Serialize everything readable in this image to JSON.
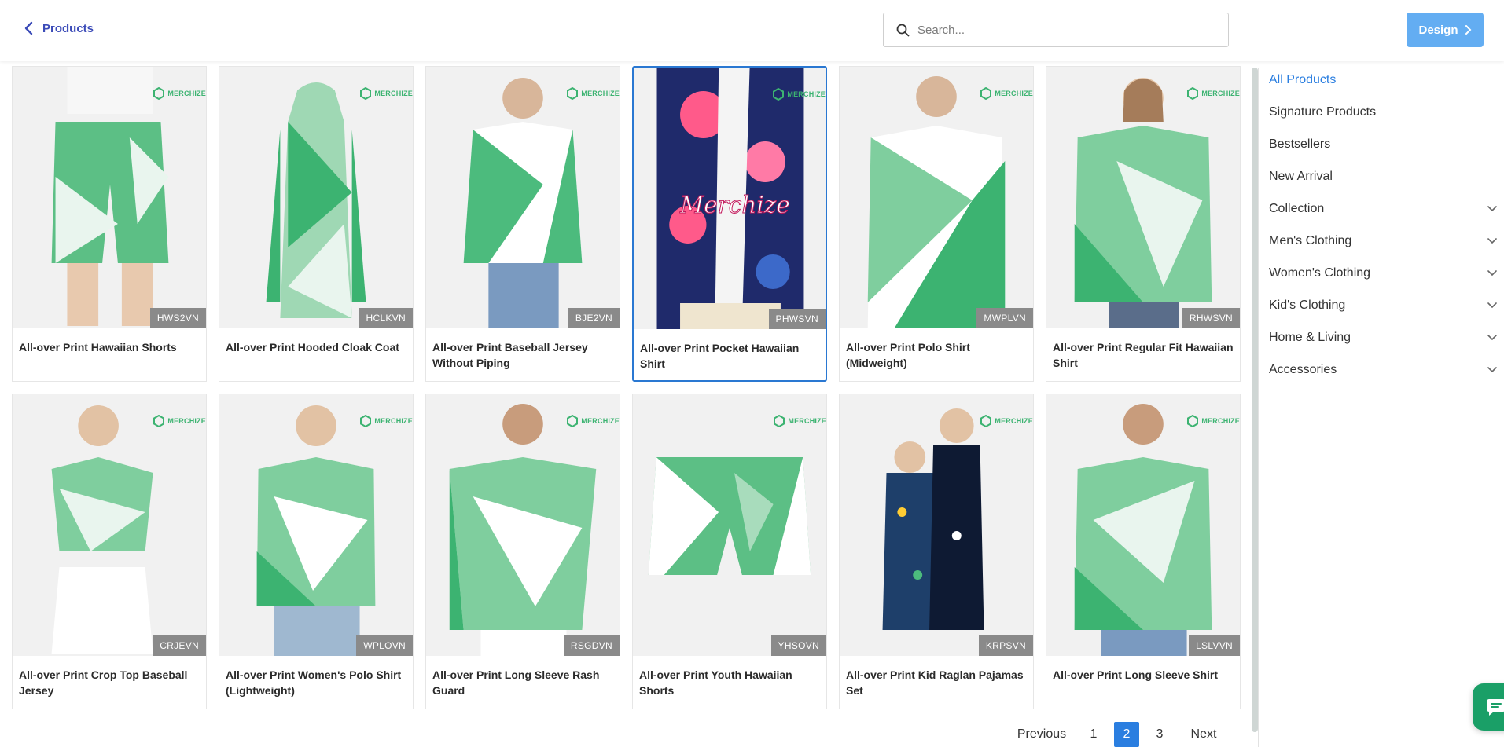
{
  "header": {
    "back_label": "Products",
    "search_placeholder": "Search...",
    "design_label": "Design"
  },
  "brand_text": "MERCHIZE",
  "products": [
    {
      "title": "All-over Print Hawaiian Shorts",
      "sku": "HWS2VN"
    },
    {
      "title": "All-over Print Hooded Cloak Coat",
      "sku": "HCLKVN"
    },
    {
      "title": "All-over Print Baseball Jersey Without Piping",
      "sku": "BJE2VN"
    },
    {
      "title": "All-over Print Pocket Hawaiian Shirt",
      "sku": "PHWSVN"
    },
    {
      "title": "All-over Print Polo Shirt (Midweight)",
      "sku": "MWPLVN"
    },
    {
      "title": "All-over Print Regular Fit Hawaiian Shirt",
      "sku": "RHWSVN"
    },
    {
      "title": "All-over Print Crop Top Baseball Jersey",
      "sku": "CRJEVN"
    },
    {
      "title": "All-over Print Women's Polo Shirt (Lightweight)",
      "sku": "WPLOVN"
    },
    {
      "title": "All-over Print Long Sleeve Rash Guard",
      "sku": "RSGDVN"
    },
    {
      "title": "All-over Print Youth Hawaiian Shorts",
      "sku": "YHSOVN"
    },
    {
      "title": "All-over Print Kid Raglan Pajamas Set",
      "sku": "KRPSVN"
    },
    {
      "title": "All-over Print Long Sleeve Shirt",
      "sku": "LSLVVN"
    }
  ],
  "sidebar": {
    "items": [
      {
        "label": "All Products"
      },
      {
        "label": "Signature Products"
      },
      {
        "label": "Bestsellers"
      },
      {
        "label": "New Arrival"
      },
      {
        "label": "Collection"
      },
      {
        "label": "Men's Clothing"
      },
      {
        "label": "Women's Clothing"
      },
      {
        "label": "Kid's Clothing"
      },
      {
        "label": "Home & Living"
      },
      {
        "label": "Accessories"
      }
    ]
  },
  "pagination": {
    "prev": "Previous",
    "pages": [
      "1",
      "2",
      "3"
    ],
    "current": "2",
    "next": "Next"
  },
  "colors": {
    "accent": "#2a7ee0",
    "design_button": "#63adf2",
    "green_print": "#3cb371",
    "chat": "#1a9f67"
  }
}
